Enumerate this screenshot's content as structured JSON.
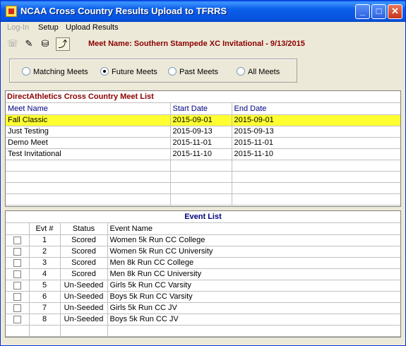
{
  "window": {
    "title": "NCAA Cross Country Results Upload to TFRRS"
  },
  "titlebar_buttons": {
    "minimize": "_",
    "maximize": "□",
    "close": "✕"
  },
  "menu": [
    {
      "label": "Log-In",
      "disabled": true
    },
    {
      "label": "Setup",
      "disabled": false
    },
    {
      "label": "Upload Results",
      "disabled": false
    }
  ],
  "toolbar": {
    "icons": [
      "phone-icon",
      "checklist-icon",
      "upload-icon",
      "back-folder-icon"
    ],
    "meet_name_label": "Meet Name:  Southern Stampede XC Invitational - 9/13/2015"
  },
  "filters": {
    "options": [
      "Matching Meets",
      "Future Meets",
      "Past Meets",
      "All Meets"
    ],
    "selected": "Future Meets"
  },
  "meet_list": {
    "title": "DirectAthletics Cross Country Meet List",
    "columns": [
      "Meet Name",
      "Start Date",
      "End Date"
    ],
    "rows": [
      {
        "name": "Fall Classic",
        "start": "2015-09-01",
        "end": "2015-09-01",
        "selected": true
      },
      {
        "name": "Just Testing",
        "start": "2015-09-13",
        "end": "2015-09-13",
        "selected": false
      },
      {
        "name": "Demo Meet",
        "start": "2015-11-01",
        "end": "2015-11-01",
        "selected": false
      },
      {
        "name": "Test Invitational",
        "start": "2015-11-10",
        "end": "2015-11-10",
        "selected": false
      }
    ],
    "selected_color": "#ffff32",
    "title_color": "#8b0000",
    "header_color": "#000080"
  },
  "event_list": {
    "title": "Event List",
    "columns": [
      "",
      "Evt #",
      "Status",
      "Event Name"
    ],
    "rows": [
      {
        "num": "1",
        "status": "Scored",
        "name": "Women 5k Run CC College"
      },
      {
        "num": "2",
        "status": "Scored",
        "name": "Women 5k Run CC University"
      },
      {
        "num": "3",
        "status": "Scored",
        "name": "Men 8k Run CC College"
      },
      {
        "num": "4",
        "status": "Scored",
        "name": "Men 8k Run CC University"
      },
      {
        "num": "5",
        "status": "Un-Seeded",
        "name": "Girls 5k Run CC Varsity"
      },
      {
        "num": "6",
        "status": "Un-Seeded",
        "name": "Boys 5k Run CC Varsity"
      },
      {
        "num": "7",
        "status": "Un-Seeded",
        "name": "Girls 5k Run CC JV"
      },
      {
        "num": "8",
        "status": "Un-Seeded",
        "name": "Boys 5k Run CC JV"
      }
    ],
    "title_color": "#000080"
  }
}
